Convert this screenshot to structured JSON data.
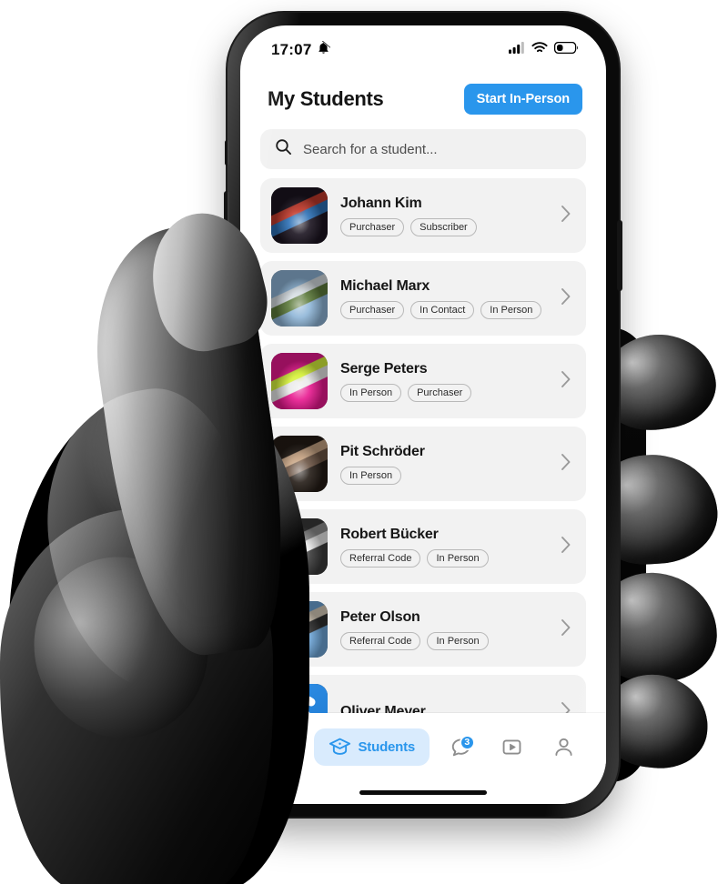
{
  "status_bar": {
    "time": "17:07",
    "silent_icon": "bell-muted-icon",
    "signal_icon": "cellular-signal-icon",
    "wifi_icon": "wifi-icon",
    "battery_icon": "battery-low-icon"
  },
  "header": {
    "title": "My Students",
    "start_button": "Start In-Person",
    "accent_color": "#2a96ec"
  },
  "search": {
    "placeholder": "Search for a student...",
    "icon": "search-icon"
  },
  "students": [
    {
      "name": "Johann Kim",
      "tags": [
        "Purchaser",
        "Subscriber"
      ],
      "avatar": "photo-portrait-man-dark-red-blue",
      "avatar_colors": [
        "#1b1420",
        "#c0392b",
        "#2b6fb5"
      ]
    },
    {
      "name": "Michael Marx",
      "tags": [
        "Purchaser",
        "In Contact",
        "In Person"
      ],
      "avatar": "photo-outdoor-field-sky",
      "avatar_colors": [
        "#8fb6d8",
        "#d6dde2",
        "#5c7a3a"
      ]
    },
    {
      "name": "Serge Peters",
      "tags": [
        "In Person",
        "Purchaser"
      ],
      "avatar": "photo-soccer-players-pink-background",
      "avatar_colors": [
        "#e8188f",
        "#d7f23a",
        "#e8e8e8"
      ]
    },
    {
      "name": "Pit Schröder",
      "tags": [
        "In Person"
      ],
      "avatar": "photo-indoor-people-warm",
      "avatar_colors": [
        "#241c16",
        "#c6a383",
        "#6b5444"
      ]
    },
    {
      "name": "Robert Bücker",
      "tags": [
        "Referral Code",
        "In Person"
      ],
      "avatar": "photo-man-white-shirt-grayscale",
      "avatar_colors": [
        "#3a3a3a",
        "#8e8e8e",
        "#e9e9e9"
      ]
    },
    {
      "name": "Peter Olson",
      "tags": [
        "Referral Code",
        "In Person"
      ],
      "avatar": "photo-street-alley-person",
      "avatar_colors": [
        "#6ea6d8",
        "#d9cdbb",
        "#2f2f2f"
      ]
    },
    {
      "name": "Oliver Meyer",
      "tags": [],
      "avatar": "logo-blue-s-swoosh",
      "avatar_colors": [
        "#2f8fe8",
        "#ffffff",
        "#2f8fe8"
      ]
    }
  ],
  "chevron_icon": "chevron-right-icon",
  "tabbar": {
    "items": [
      {
        "id": "home",
        "label": "",
        "icon": "home-icon",
        "active": false,
        "badge_dot": true
      },
      {
        "id": "students",
        "label": "Students",
        "icon": "graduation-cap-icon",
        "active": true,
        "badge_dot": false
      },
      {
        "id": "chat",
        "label": "",
        "icon": "chat-bubble-icon",
        "active": false,
        "badge_count": "3"
      },
      {
        "id": "videos",
        "label": "",
        "icon": "play-square-icon",
        "active": false
      },
      {
        "id": "profile",
        "label": "",
        "icon": "person-icon",
        "active": false
      }
    ]
  },
  "home_indicator": "home-indicator-bar"
}
